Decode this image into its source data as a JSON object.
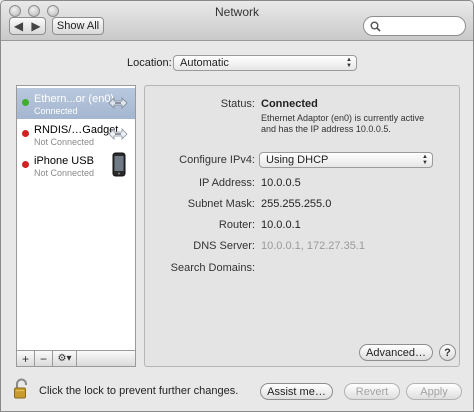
{
  "window": {
    "title": "Network"
  },
  "toolbar": {
    "back_icon": "chevron-left-icon",
    "forward_icon": "chevron-right-icon",
    "show_all_label": "Show All",
    "search_placeholder": ""
  },
  "location": {
    "label": "Location:",
    "value": "Automatic"
  },
  "services": [
    {
      "name": "Ethern...or (en0)",
      "status": "Connected",
      "status_color": "#3fae2a",
      "icon": "ethernet-arrows-icon",
      "selected": true
    },
    {
      "name": "RNDIS/…Gadget",
      "status": "Not Connected",
      "status_color": "#d32020",
      "icon": "ethernet-arrows-icon",
      "selected": false
    },
    {
      "name": "iPhone USB",
      "status": "Not Connected",
      "status_color": "#d32020",
      "icon": "iphone-icon",
      "selected": false
    }
  ],
  "sidebar_controls": {
    "add_label": "+",
    "remove_label": "−",
    "gear_label": "⚙▾"
  },
  "detail": {
    "status_label": "Status:",
    "status_value": "Connected",
    "status_description_line1": "Ethernet Adaptor (en0) is currently active",
    "status_description_line2": "and has the IP address 10.0.0.5.",
    "configure_label": "Configure IPv4:",
    "configure_value": "Using DHCP",
    "ip_label": "IP Address:",
    "ip_value": "10.0.0.5",
    "subnet_label": "Subnet Mask:",
    "subnet_value": "255.255.255.0",
    "router_label": "Router:",
    "router_value": "10.0.0.1",
    "dns_label": "DNS Server:",
    "dns_value": "10.0.0.1, 172.27.35.1",
    "search_domains_label": "Search Domains:",
    "search_domains_value": "",
    "advanced_label": "Advanced…",
    "help_label": "?"
  },
  "footer": {
    "lock_text": "Click the lock to prevent further changes.",
    "assist_label": "Assist me…",
    "revert_label": "Revert",
    "apply_label": "Apply"
  }
}
